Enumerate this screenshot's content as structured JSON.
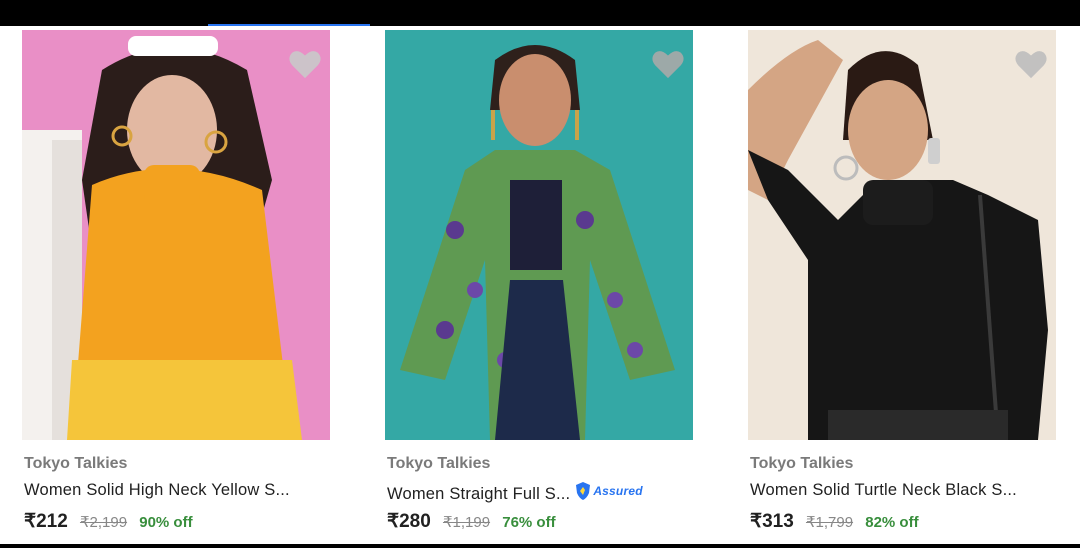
{
  "products": [
    {
      "brand": "Tokyo Talkies",
      "title": "Women Solid High Neck Yellow S...",
      "price": "₹212",
      "mrp": "₹2,199",
      "discount": "90% off",
      "assured": false,
      "colors": {
        "background": "#e98fc6",
        "garment": "#f3a21f"
      }
    },
    {
      "brand": "Tokyo Talkies",
      "title": "Women Straight Full S...",
      "price": "₹280",
      "mrp": "₹1,199",
      "discount": "76% off",
      "assured": true,
      "assured_label": "Assured",
      "colors": {
        "background": "#34a8a5",
        "garment": "#5f9a52"
      }
    },
    {
      "brand": "Tokyo Talkies",
      "title": "Women Solid Turtle Neck Black S...",
      "price": "₹313",
      "mrp": "₹1,799",
      "discount": "82% off",
      "assured": false,
      "colors": {
        "background": "#efe6da",
        "garment": "#161616"
      }
    }
  ],
  "colors": {
    "accent": "#2874f0",
    "discount": "#388e3c"
  }
}
